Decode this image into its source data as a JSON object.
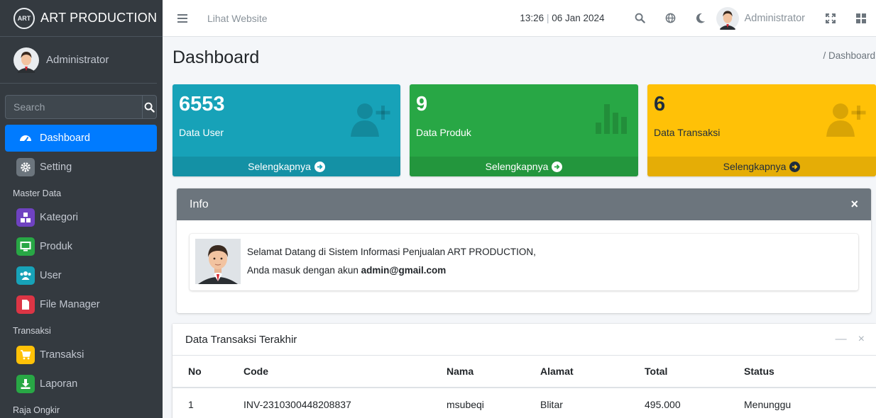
{
  "brand": {
    "name": "ART PRODUCTION",
    "logo_text": "ART"
  },
  "sidebar": {
    "user_name": "Administrator",
    "search_placeholder": "Search",
    "items": [
      {
        "label": "Dashboard",
        "icon": "dashboard-icon",
        "active": true
      },
      {
        "label": "Setting",
        "icon": "gear-icon"
      }
    ],
    "section_master": "Master Data",
    "master_items": [
      {
        "label": "Kategori",
        "icon": "category-icon"
      },
      {
        "label": "Produk",
        "icon": "monitor-icon"
      },
      {
        "label": "User",
        "icon": "users-icon"
      },
      {
        "label": "File Manager",
        "icon": "file-icon"
      }
    ],
    "section_transaksi": "Transaksi",
    "transaksi_items": [
      {
        "label": "Transaksi",
        "icon": "cart-icon"
      },
      {
        "label": "Laporan",
        "icon": "download-icon"
      }
    ],
    "section_raja": "Raja Ongkir"
  },
  "topbar": {
    "link": "Lihat Website",
    "time": "13:26",
    "date": "06 Jan 2024",
    "user_name": "Administrator"
  },
  "page": {
    "title": "Dashboard",
    "breadcrumb": "/ Dashboard"
  },
  "stats": [
    {
      "value": "6553",
      "label": "Data User",
      "more": "Selengkapnya",
      "color": "#17a2b8"
    },
    {
      "value": "9",
      "label": "Data Produk",
      "more": "Selengkapnya",
      "color": "#28a745"
    },
    {
      "value": "6",
      "label": "Data Transaksi",
      "more": "Selengkapnya",
      "color": "#ffc107"
    }
  ],
  "info": {
    "title": "Info",
    "line1": "Selamat Datang di Sistem Informasi Penjualan ART PRODUCTION,",
    "line2_prefix": "Anda masuk dengan akun ",
    "email": "admin@gmail.com"
  },
  "transactions": {
    "title": "Data Transaksi Terakhir",
    "columns": [
      "No",
      "Code",
      "Nama",
      "Alamat",
      "Total",
      "Status"
    ],
    "rows": [
      [
        "1",
        "INV-2310300448208837",
        "msubeqi",
        "Blitar",
        "495.000",
        "Menunggu"
      ]
    ]
  }
}
